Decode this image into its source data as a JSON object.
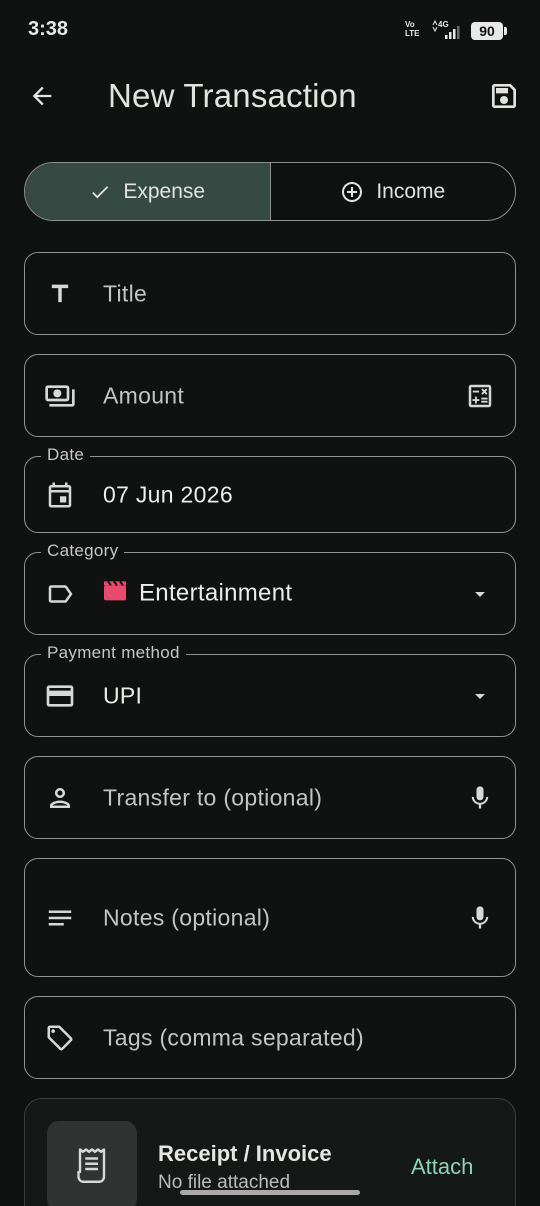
{
  "status_bar": {
    "time": "3:38",
    "volte_top": "Vo",
    "volte_bottom": "LTE",
    "network": "4G",
    "battery": "90"
  },
  "header": {
    "title": "New Transaction",
    "back_icon": "arrow-back-icon",
    "save_icon": "save-icon"
  },
  "type_toggle": {
    "expense": {
      "label": "Expense",
      "icon": "check-icon",
      "selected": true
    },
    "income": {
      "label": "Income",
      "icon": "add-circle-icon",
      "selected": false
    },
    "accent": "#354a43"
  },
  "form": {
    "title": {
      "placeholder": "Title",
      "icon": "text-icon"
    },
    "amount": {
      "placeholder": "Amount",
      "icon": "payments-icon",
      "trail_icon": "calculator-icon"
    },
    "date": {
      "label": "Date",
      "value": "07 Jun 2026",
      "icon": "calendar-icon"
    },
    "category": {
      "label": "Category",
      "value": "Entertainment",
      "icon": "label-icon",
      "emoji_icon": "clapperboard-icon",
      "emoji_color": "#e84a6f"
    },
    "payment_method": {
      "label": "Payment method",
      "value": "UPI",
      "icon": "credit-card-icon"
    },
    "transfer_to": {
      "placeholder": "Transfer to (optional)",
      "icon": "person-icon",
      "trail_icon": "mic-icon"
    },
    "notes": {
      "placeholder": "Notes (optional)",
      "icon": "notes-icon",
      "trail_icon": "mic-icon"
    },
    "tags": {
      "placeholder": "Tags (comma separated)",
      "icon": "tag-icon"
    }
  },
  "receipt": {
    "title": "Receipt / Invoice",
    "subtitle": "No file attached",
    "action": "Attach",
    "icon": "receipt-icon",
    "action_color": "#8fd3b6"
  }
}
